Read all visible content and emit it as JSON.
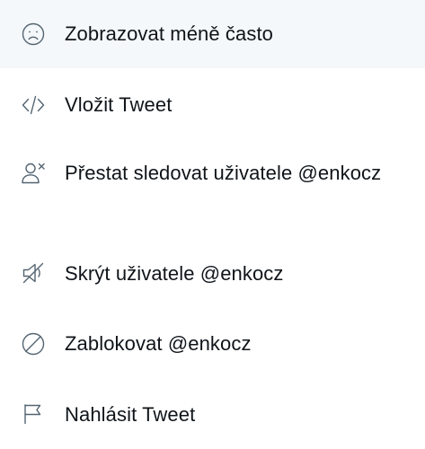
{
  "menu": {
    "items": [
      {
        "icon": "sad-face-icon",
        "label": "Zobrazovat méně často",
        "highlighted": true
      },
      {
        "icon": "code-embed-icon",
        "label": "Vložit Tweet"
      },
      {
        "icon": "unfollow-user-icon",
        "label": "Přestat sledovat uživatele @enkocz"
      },
      {
        "icon": "mute-icon",
        "label": "Skrýt uživatele @enkocz"
      },
      {
        "icon": "block-icon",
        "label": "Zablokovat @enkocz"
      },
      {
        "icon": "report-flag-icon",
        "label": "Nahlásit Tweet"
      }
    ]
  },
  "colors": {
    "text": "#0f1419",
    "icon": "#536471",
    "hover_background": "#f5f8fa",
    "background": "#ffffff"
  }
}
